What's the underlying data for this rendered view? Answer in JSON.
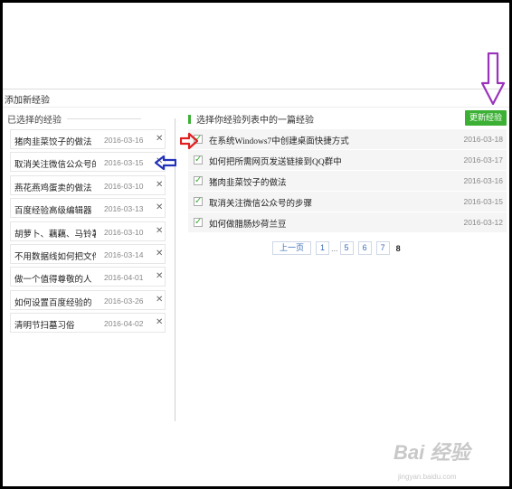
{
  "panel_title": "添加新经验",
  "left": {
    "header": "已选择的经验",
    "items": [
      {
        "title": "猪肉韭菜饺子的做法",
        "date": "2016-03-16",
        "remove": "✕"
      },
      {
        "title": "取消关注微信公众号的步骤",
        "date": "2016-03-15",
        "remove": "✕"
      },
      {
        "title": "燕花燕鸡蛋卖的做法",
        "date": "2016-03-10",
        "remove": "✕"
      },
      {
        "title": "百度经验高级编辑器",
        "date": "2016-03-13",
        "remove": "✕"
      },
      {
        "title": "胡萝卜、藕藕、马铃薯",
        "date": "2016-03-10",
        "remove": "✕"
      },
      {
        "title": "不用数据线如何把文件",
        "date": "2016-03-14",
        "remove": "✕"
      },
      {
        "title": "做一个值得尊敬的人",
        "date": "2016-04-01",
        "remove": "✕"
      },
      {
        "title": "如何设置百度经验的",
        "date": "2016-03-26",
        "remove": "✕"
      },
      {
        "title": "清明节扫墓习俗",
        "date": "2016-04-02",
        "remove": "✕"
      }
    ]
  },
  "right": {
    "header": "选择你经验列表中的一篇经验",
    "update_button": "更新经验",
    "items": [
      {
        "title": "在系统Windows7中创建桌面快捷方式",
        "date": "2016-03-18"
      },
      {
        "title": "如何把所需网页发送链接到QQ群中",
        "date": "2016-03-17"
      },
      {
        "title": "猪肉韭菜饺子的做法",
        "date": "2016-03-16"
      },
      {
        "title": "取消关注微信公众号的步骤",
        "date": "2016-03-15"
      },
      {
        "title": "如何做腊肠炒荷兰豆",
        "date": "2016-03-12"
      }
    ],
    "pagination": {
      "prev": "上一页",
      "pages": [
        "1",
        "5",
        "6",
        "7"
      ],
      "ellipsis": "...",
      "current": "8"
    }
  },
  "watermark": {
    "logo": "Bai 经验",
    "url": "jingyan.baidu.com"
  },
  "colors": {
    "green": "#3cb034",
    "red_arrow": "#e02020",
    "blue_arrow": "#2233bb",
    "purple_arrow": "#9933bb"
  }
}
